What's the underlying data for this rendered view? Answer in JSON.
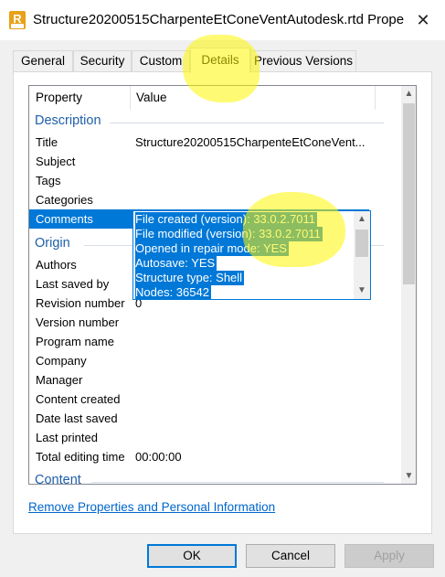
{
  "window": {
    "title": "Structure20200515CharpenteEtConeVentAutodesk.rtd Prope…",
    "icon": "rtd-file-icon",
    "close": "✕"
  },
  "tabs": [
    {
      "label": "General"
    },
    {
      "label": "Security"
    },
    {
      "label": "Custom"
    },
    {
      "label": "Details",
      "active": true
    },
    {
      "label": "Previous Versions"
    }
  ],
  "list": {
    "header_property": "Property",
    "header_value": "Value",
    "sections": {
      "description": "Description",
      "origin": "Origin",
      "content": "Content"
    },
    "rows": [
      {
        "label": "Title",
        "value": "Structure20200515CharpenteEtConeVent..."
      },
      {
        "label": "Subject",
        "value": ""
      },
      {
        "label": "Tags",
        "value": ""
      },
      {
        "label": "Categories",
        "value": ""
      },
      {
        "label": "Comments",
        "value": ""
      },
      {
        "label": "Authors",
        "value": ""
      },
      {
        "label": "Last saved by",
        "value": ""
      },
      {
        "label": "Revision number",
        "value": "0"
      },
      {
        "label": "Version number",
        "value": ""
      },
      {
        "label": "Program name",
        "value": ""
      },
      {
        "label": "Company",
        "value": ""
      },
      {
        "label": "Manager",
        "value": ""
      },
      {
        "label": "Content created",
        "value": ""
      },
      {
        "label": "Date last saved",
        "value": ""
      },
      {
        "label": "Last printed",
        "value": ""
      },
      {
        "label": "Total editing time",
        "value": "00:00:00"
      }
    ],
    "comments_lines": [
      "File created (version): 33.0.2.7011",
      "File modified (version): 33.0.2.7011",
      "Opened in repair mode: YES",
      "Autosave: YES",
      "Structure type: Shell",
      "Nodes: 36542"
    ]
  },
  "link": "Remove Properties and Personal Information",
  "buttons": {
    "ok": "OK",
    "cancel": "Cancel",
    "apply": "Apply"
  },
  "colors": {
    "accent": "#0078d7",
    "section": "#1e5fa8",
    "highlighter": "#fff500"
  }
}
